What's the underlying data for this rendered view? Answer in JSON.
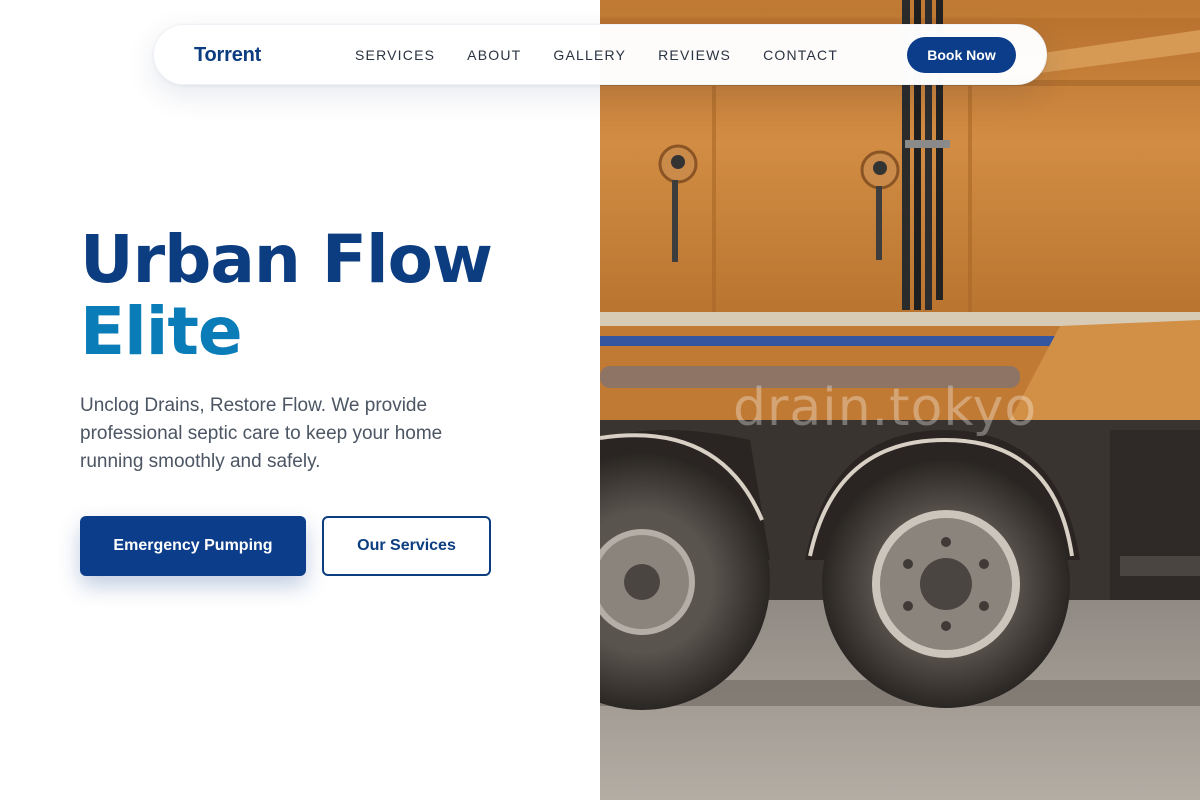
{
  "brand": {
    "name": "Torrent"
  },
  "nav": {
    "items": [
      {
        "label": "SERVICES"
      },
      {
        "label": "ABOUT"
      },
      {
        "label": "GALLERY"
      },
      {
        "label": "REVIEWS"
      },
      {
        "label": "CONTACT"
      }
    ],
    "cta_label": "Book Now"
  },
  "hero": {
    "title_line1": "Urban Flow",
    "title_line2": "Elite",
    "tagline": "Unclog Drains, Restore Flow. We provide professional septic care to keep your home running smoothly and safely.",
    "primary_button": "Emergency Pumping",
    "secondary_button": "Our Services",
    "image_watermark": "drain.tokyo"
  },
  "colors": {
    "brand_navy": "#0b3d80",
    "accent_blue": "#0a7cb8",
    "button_navy": "#0b3d8a",
    "tank_orange": "#c98438"
  }
}
